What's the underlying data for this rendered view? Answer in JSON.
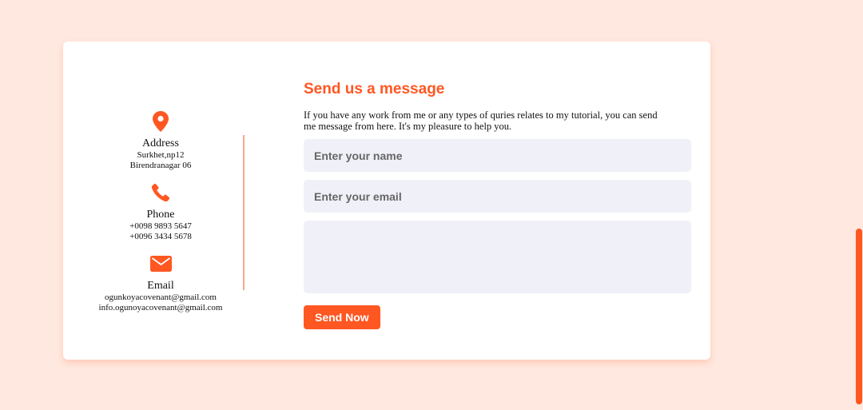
{
  "colors": {
    "page_background": "#ffe8df",
    "accent": "#ff5722",
    "field_background": "#f0f0f8",
    "divider": "#f4a98c"
  },
  "contact": {
    "address": {
      "icon": "location-pin-icon",
      "title": "Address",
      "lines": [
        "Surkhet,np12",
        "Birendranagar 06"
      ]
    },
    "phone": {
      "icon": "phone-icon",
      "title": "Phone",
      "lines": [
        "+0098 9893 5647",
        "+0096 3434 5678"
      ]
    },
    "email": {
      "icon": "envelope-icon",
      "title": "Email",
      "lines": [
        "ogunkoyacovenant@gmail.com",
        "info.ogunoyacovenant@gmail.com"
      ]
    }
  },
  "form": {
    "heading": "Send us a message",
    "description": "If you have any work from me or any types of quries relates to my tutorial, you can send me message from here. It's my pleasure to help you.",
    "name_placeholder": "Enter your name",
    "name_value": "",
    "email_placeholder": "Enter your email",
    "email_value": "",
    "message_value": "",
    "submit_label": "Send Now"
  }
}
